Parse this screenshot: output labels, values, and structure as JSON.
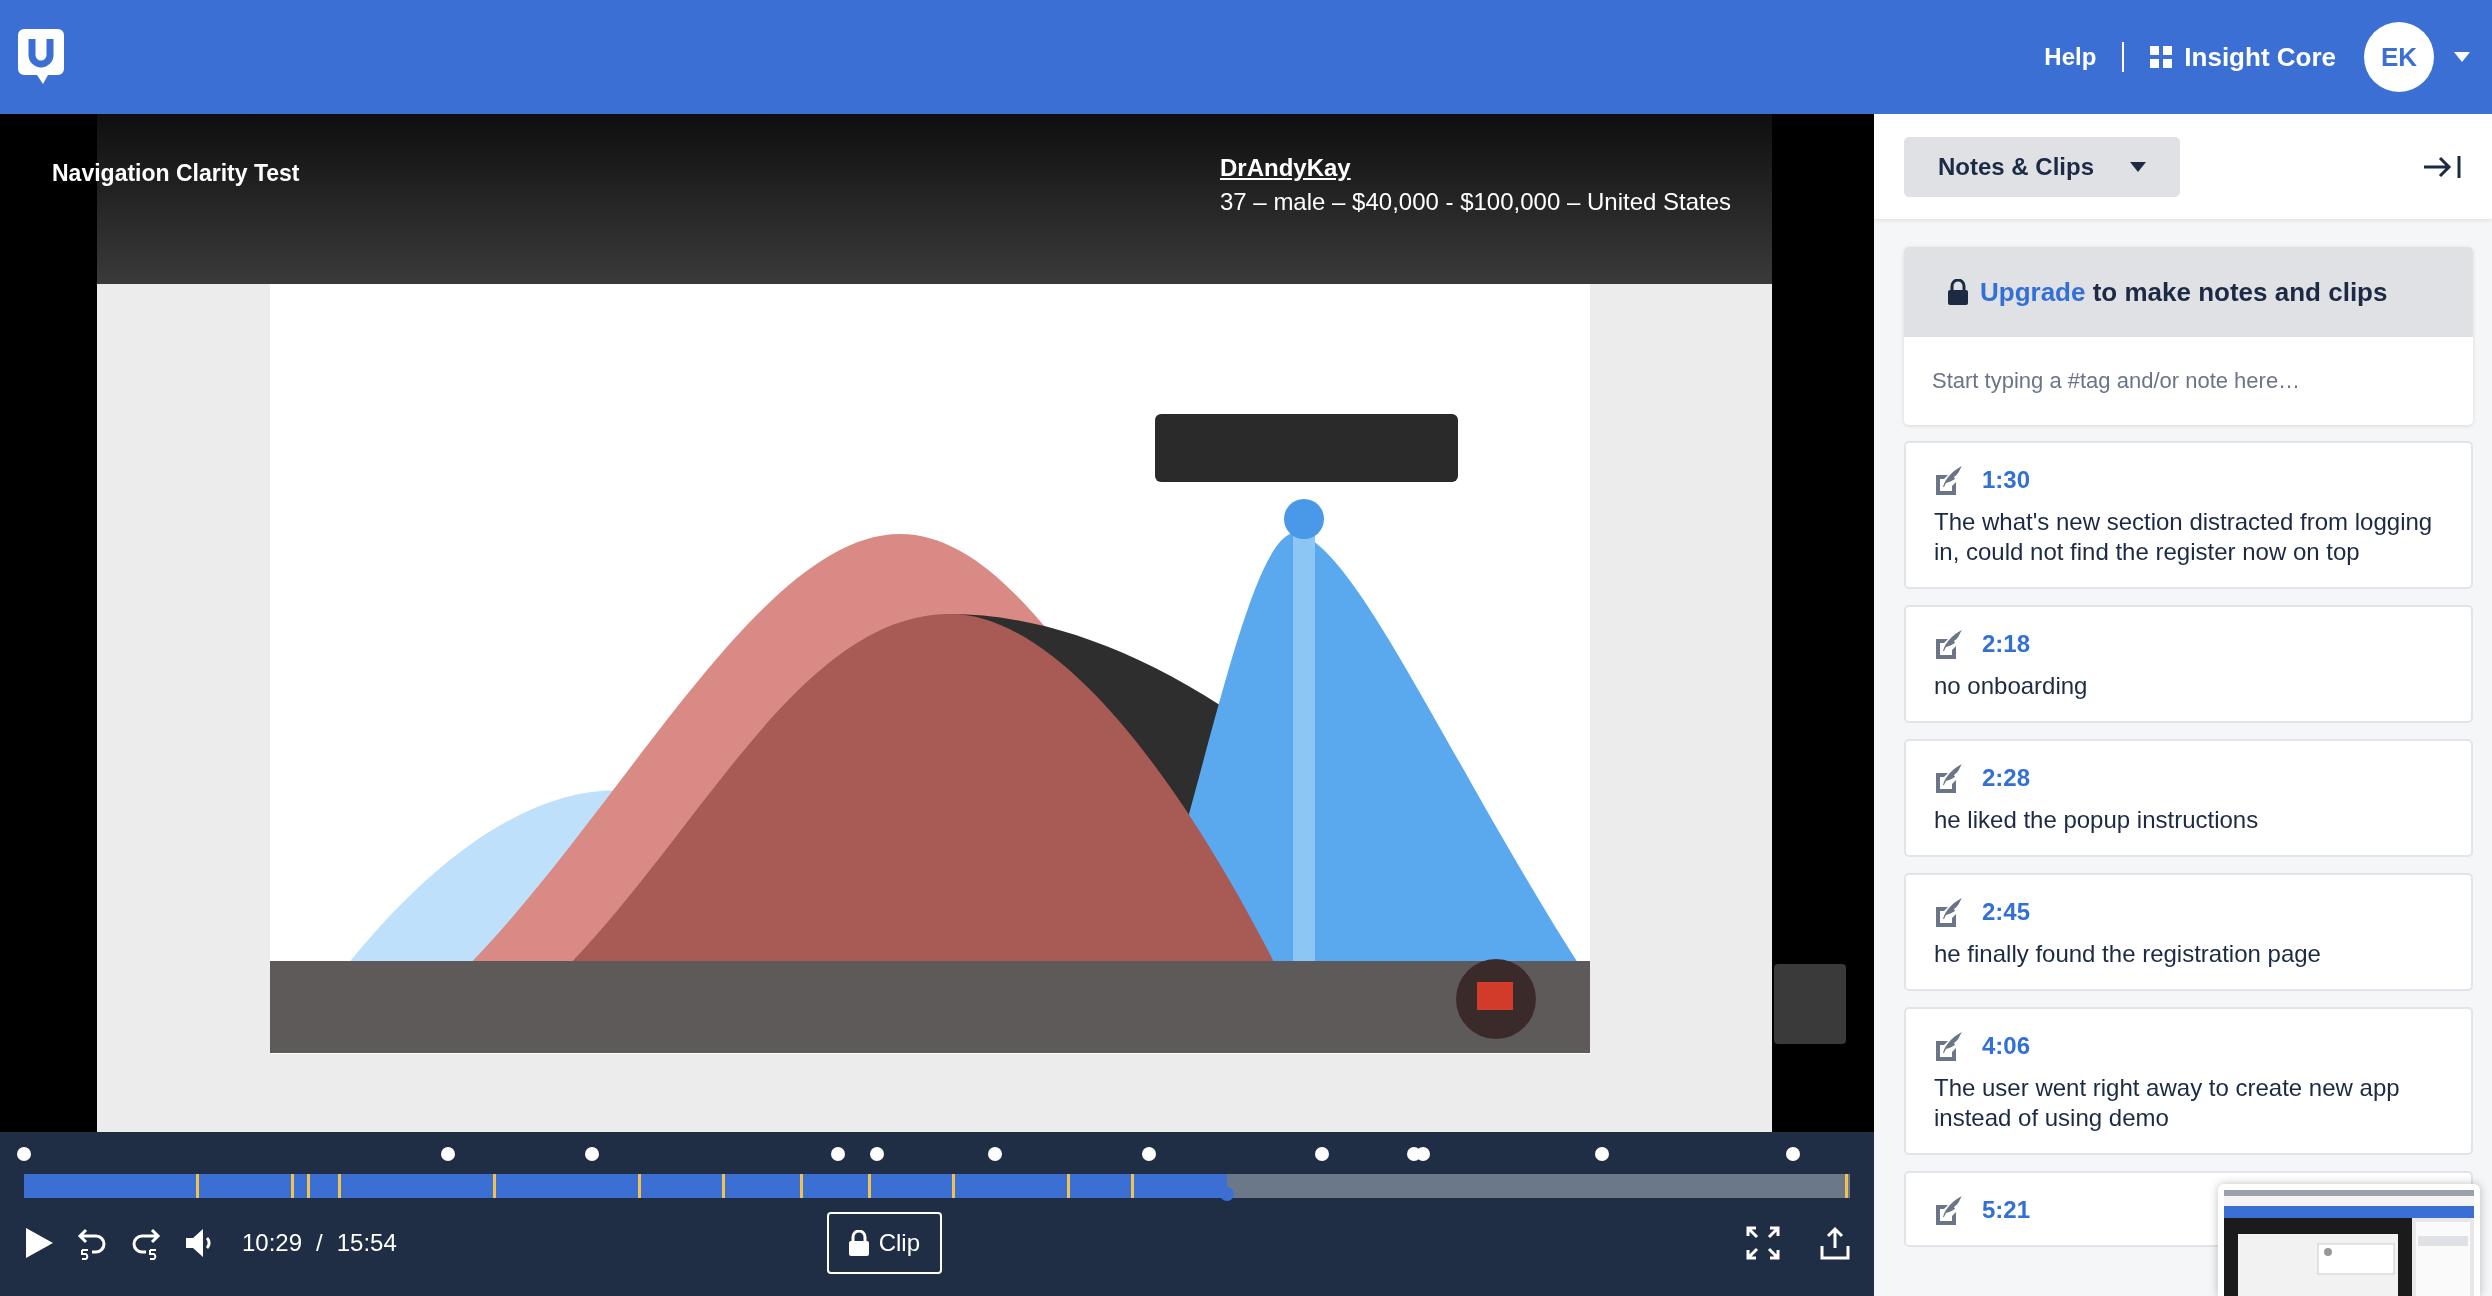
{
  "header": {
    "help": "Help",
    "workspace": "Insight Core",
    "avatar": "EK"
  },
  "video": {
    "kind": "picture",
    "test_title": "Navigation Clarity Test",
    "tester": {
      "name": "DrAndyKay",
      "details": "37 – male – $40,000 - $100,000 – United States"
    }
  },
  "player": {
    "progress": {
      "level": 0.659
    },
    "current_time": "10:29",
    "separator": "/",
    "duration": "15:54",
    "clip_button": "Clip"
  },
  "sidebar": {
    "panel_menu": "Notes & Clips",
    "upgrade": {
      "link": "Upgrade",
      "text": "to make notes and clips"
    },
    "note_field": {
      "placeholder": "Start typing a #tag and/or note here…"
    },
    "notes": [
      {
        "time": "1:30",
        "text": "The what's new section distracted from logging in, could not find the register now on top"
      },
      {
        "time": "2:18",
        "text": "no onboarding"
      },
      {
        "time": "2:28",
        "text": "he liked the popup instructions"
      },
      {
        "time": "2:45",
        "text": "he finally found the registration page"
      },
      {
        "time": "4:06",
        "text": "The user went right away to create new app instead of using demo"
      },
      {
        "time": "5:21"
      }
    ]
  }
}
